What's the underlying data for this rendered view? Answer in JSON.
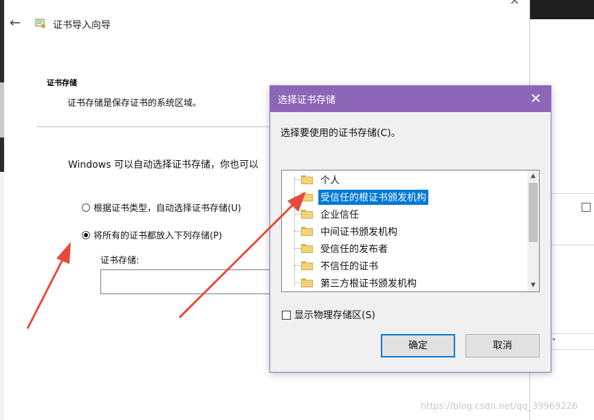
{
  "wizard": {
    "title": "证书导入向导",
    "section_heading": "证书存储",
    "section_desc": "证书存储是保存证书的系统区域。",
    "auto_text": "Windows 可以自动选择证书存储，你也可以",
    "radio_auto_label": "根据证书类型，自动选择证书存储(U)",
    "radio_manual_label": "将所有的证书都放入下列存储(P)",
    "radio_selected": "manual",
    "store_label": "证书存储:",
    "store_value": ""
  },
  "dialog": {
    "title": "选择证书存储",
    "prompt": "选择要使用的证书存储(C)。",
    "stores": [
      {
        "label": "个人",
        "selected": false
      },
      {
        "label": "受信任的根证书颁发机构",
        "selected": true
      },
      {
        "label": "企业信任",
        "selected": false
      },
      {
        "label": "中间证书颁发机构",
        "selected": false
      },
      {
        "label": "受信任的发布者",
        "selected": false
      },
      {
        "label": "不信任的证书",
        "selected": false
      },
      {
        "label": "第三方根证书颁发机构",
        "selected": false
      }
    ],
    "show_physical_label": "显示物理存储区(S)",
    "show_physical_checked": false,
    "ok_label": "确定",
    "cancel_label": "取消"
  },
  "background": {
    "fragment_text": "\""
  },
  "watermark": "https://blog.csdn.net/qq_39969226",
  "colors": {
    "dialog_title_bg": "#8e66b9",
    "selection": "#0078d7",
    "arrow": "#e8493a"
  }
}
